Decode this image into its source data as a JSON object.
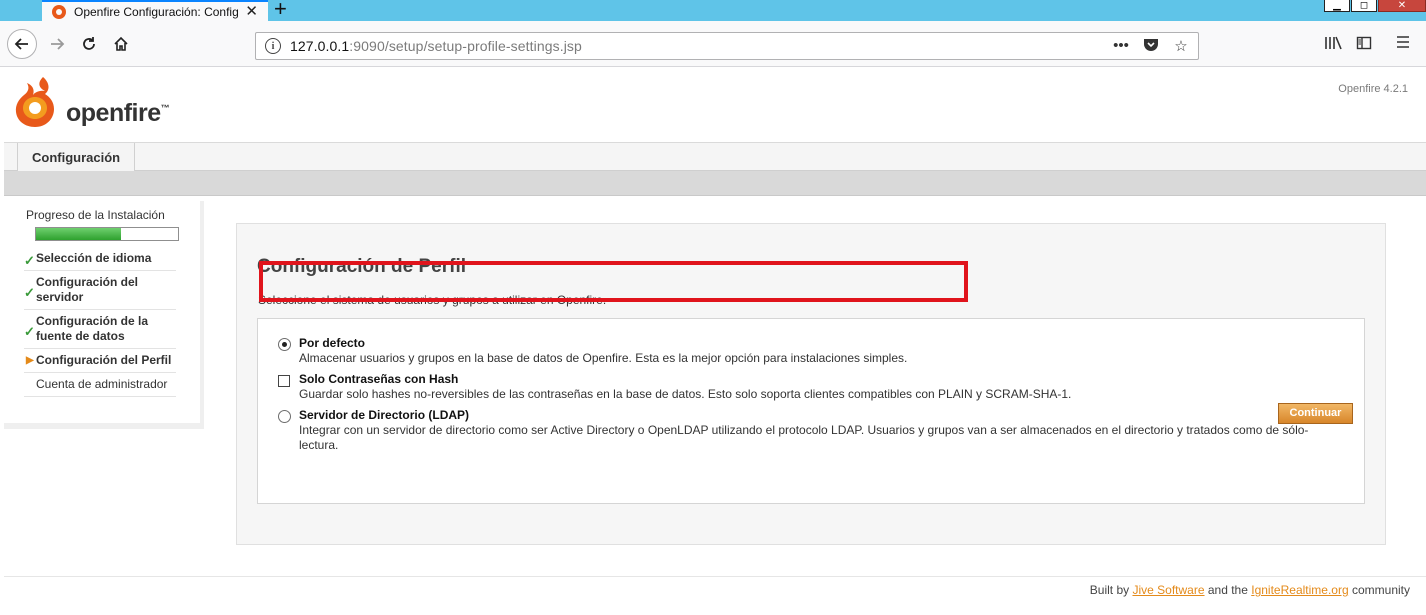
{
  "browser": {
    "tab_title": "Openfire Configuración: Config",
    "tab_close": "✕",
    "new_tab": "+",
    "url_host": "127.0.0.1",
    "url_rest": ":9090/setup/setup-profile-settings.jsp",
    "window_buttons": [
      "▁",
      "◻",
      "✕"
    ]
  },
  "header": {
    "logo_text": "openfire",
    "logo_tm": "™",
    "version": "Openfire 4.2.1"
  },
  "menu": {
    "tab_label": "Configuración"
  },
  "sidebar": {
    "progress_label": "Progreso de la Instalación",
    "progress": 0.6,
    "steps": [
      {
        "label": "Selección de idioma",
        "state": "done"
      },
      {
        "label": "Configuración del servidor",
        "state": "done"
      },
      {
        "label": "Configuración de la fuente de datos",
        "state": "done"
      },
      {
        "label": "Configuración del Perfil",
        "state": "current"
      },
      {
        "label": "Cuenta de administrador",
        "state": "pending"
      }
    ]
  },
  "main": {
    "title": "Configuración de Perfil",
    "description": "Seleccione el sistema de usuarios y grupos a utilizar en Openfire.",
    "options": [
      {
        "title": "Por defecto",
        "description": "Almacenar usuarios y grupos en la base de datos de Openfire. Esta es la mejor opción para instalaciones simples.",
        "selected": true
      },
      {
        "title": "Solo Contraseñas con Hash",
        "description": "Guardar solo hashes no-reversibles de las contraseñas en la base de datos. Esto solo soporta clientes compatibles con PLAIN y SCRAM-SHA-1.",
        "selected": false
      },
      {
        "title": "Servidor de Directorio (LDAP)",
        "description": "Integrar con un servidor de directorio como ser Active Directory o OpenLDAP utilizando el protocolo LDAP. Usuarios y grupos van a ser almacenados en el directorio y tratados como de sólo-lectura.",
        "selected": false
      }
    ],
    "continue_label": "Continuar"
  },
  "footer": {
    "built_by": "Built by",
    "jive_link": "Jive Software",
    "and_the": "and the",
    "ignite_link": "IgniteRealtime.org",
    "community": "community"
  },
  "colors": {
    "accent_orange": "#e48a1a",
    "highlight_red": "#e0141c",
    "progress_green": "#2ea12e"
  }
}
